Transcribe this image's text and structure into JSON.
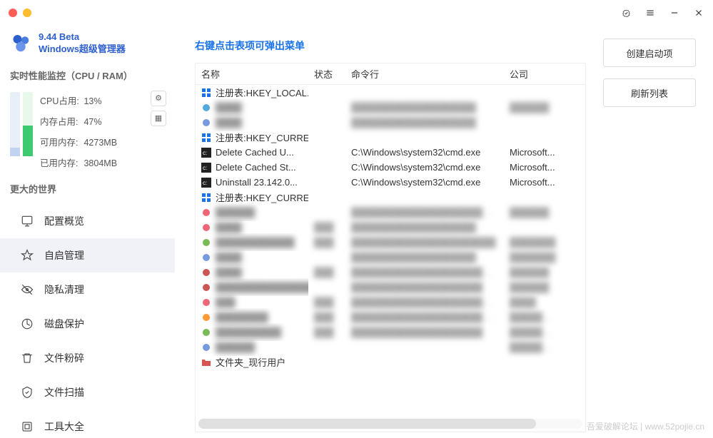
{
  "app": {
    "version": "9.44 Beta",
    "name": "Windows超级管理器"
  },
  "perf": {
    "header": "实时性能监控（CPU / RAM）",
    "cpu_label": "CPU占用:",
    "cpu_value": "13%",
    "cpu_pct": 13,
    "ram_label": "内存占用:",
    "ram_value": "47%",
    "ram_pct": 47,
    "avail_label": "可用内存:",
    "avail_value": "4273MB",
    "used_label": "已用内存:",
    "used_value": "3804MB"
  },
  "section_header": "更大的世界",
  "nav": [
    {
      "label": "配置概览",
      "icon": "overview"
    },
    {
      "label": "自启管理",
      "icon": "startup",
      "active": true
    },
    {
      "label": "隐私清理",
      "icon": "privacy"
    },
    {
      "label": "磁盘保护",
      "icon": "disk"
    },
    {
      "label": "文件粉碎",
      "icon": "shred"
    },
    {
      "label": "文件扫描",
      "icon": "scan"
    },
    {
      "label": "工具大全",
      "icon": "tools"
    }
  ],
  "hint": "右键点击表项可弹出菜单",
  "columns": {
    "name": "名称",
    "status": "状态",
    "cmd": "命令行",
    "company": "公司"
  },
  "rows": [
    {
      "type": "group",
      "icon": "reg",
      "name": "注册表:HKEY_LOCAL..."
    },
    {
      "type": "item",
      "blurred": true,
      "name": "████",
      "cmd": "███████████████████",
      "company": "██████"
    },
    {
      "type": "item",
      "blurred": true,
      "name": "████",
      "cmd": "███████████████████",
      "company": ""
    },
    {
      "type": "group",
      "icon": "reg",
      "name": "注册表:HKEY_CURRE..."
    },
    {
      "type": "item",
      "icon": "cmd",
      "name": "Delete Cached U...",
      "cmd": "C:\\Windows\\system32\\cmd.exe",
      "company": "Microsoft..."
    },
    {
      "type": "item",
      "icon": "cmd",
      "name": "Delete Cached St...",
      "cmd": "C:\\Windows\\system32\\cmd.exe",
      "company": "Microsoft..."
    },
    {
      "type": "item",
      "icon": "cmd",
      "name": "Uninstall 23.142.0...",
      "cmd": "C:\\Windows\\system32\\cmd.exe",
      "company": "Microsoft..."
    },
    {
      "type": "group",
      "icon": "reg",
      "name": "注册表:HKEY_CURRE..."
    },
    {
      "type": "item",
      "blurred": true,
      "name": "██████",
      "cmd": "███████████████████████",
      "company": "██████"
    },
    {
      "type": "item",
      "blurred": true,
      "name": "████",
      "status": "███",
      "cmd": "███████████████████",
      "company": ""
    },
    {
      "type": "item",
      "blurred": true,
      "name": "████████████",
      "status": "███",
      "cmd": "██████████████████████",
      "company": "███████"
    },
    {
      "type": "item",
      "blurred": true,
      "name": "████",
      "cmd": "███████████████████",
      "company": "███████"
    },
    {
      "type": "item",
      "blurred": true,
      "name": "████",
      "status": "███",
      "cmd": "███████████████████████",
      "company": "██████"
    },
    {
      "type": "item",
      "blurred": true,
      "name": "████████████████",
      "cmd": "████████████████████",
      "company": "██████"
    },
    {
      "type": "item",
      "blurred": true,
      "name": "███",
      "status": "███",
      "cmd": "███████████████████████",
      "company": "████"
    },
    {
      "type": "item",
      "blurred": true,
      "name": "████████",
      "status": "███",
      "cmd": "███████████████████████",
      "company": "████████"
    },
    {
      "type": "item",
      "blurred": true,
      "name": "██████████",
      "status": "███",
      "cmd": "████████████████████",
      "company": "██████████"
    },
    {
      "type": "item",
      "blurred": true,
      "name": "██████",
      "cmd": "",
      "company": "████████"
    },
    {
      "type": "group",
      "icon": "folder",
      "name": "文件夹_现行用户"
    }
  ],
  "buttons": {
    "create": "创建启动项",
    "refresh": "刷新列表"
  },
  "watermark": "吾爱破解论坛 | www.52pojie.cn"
}
